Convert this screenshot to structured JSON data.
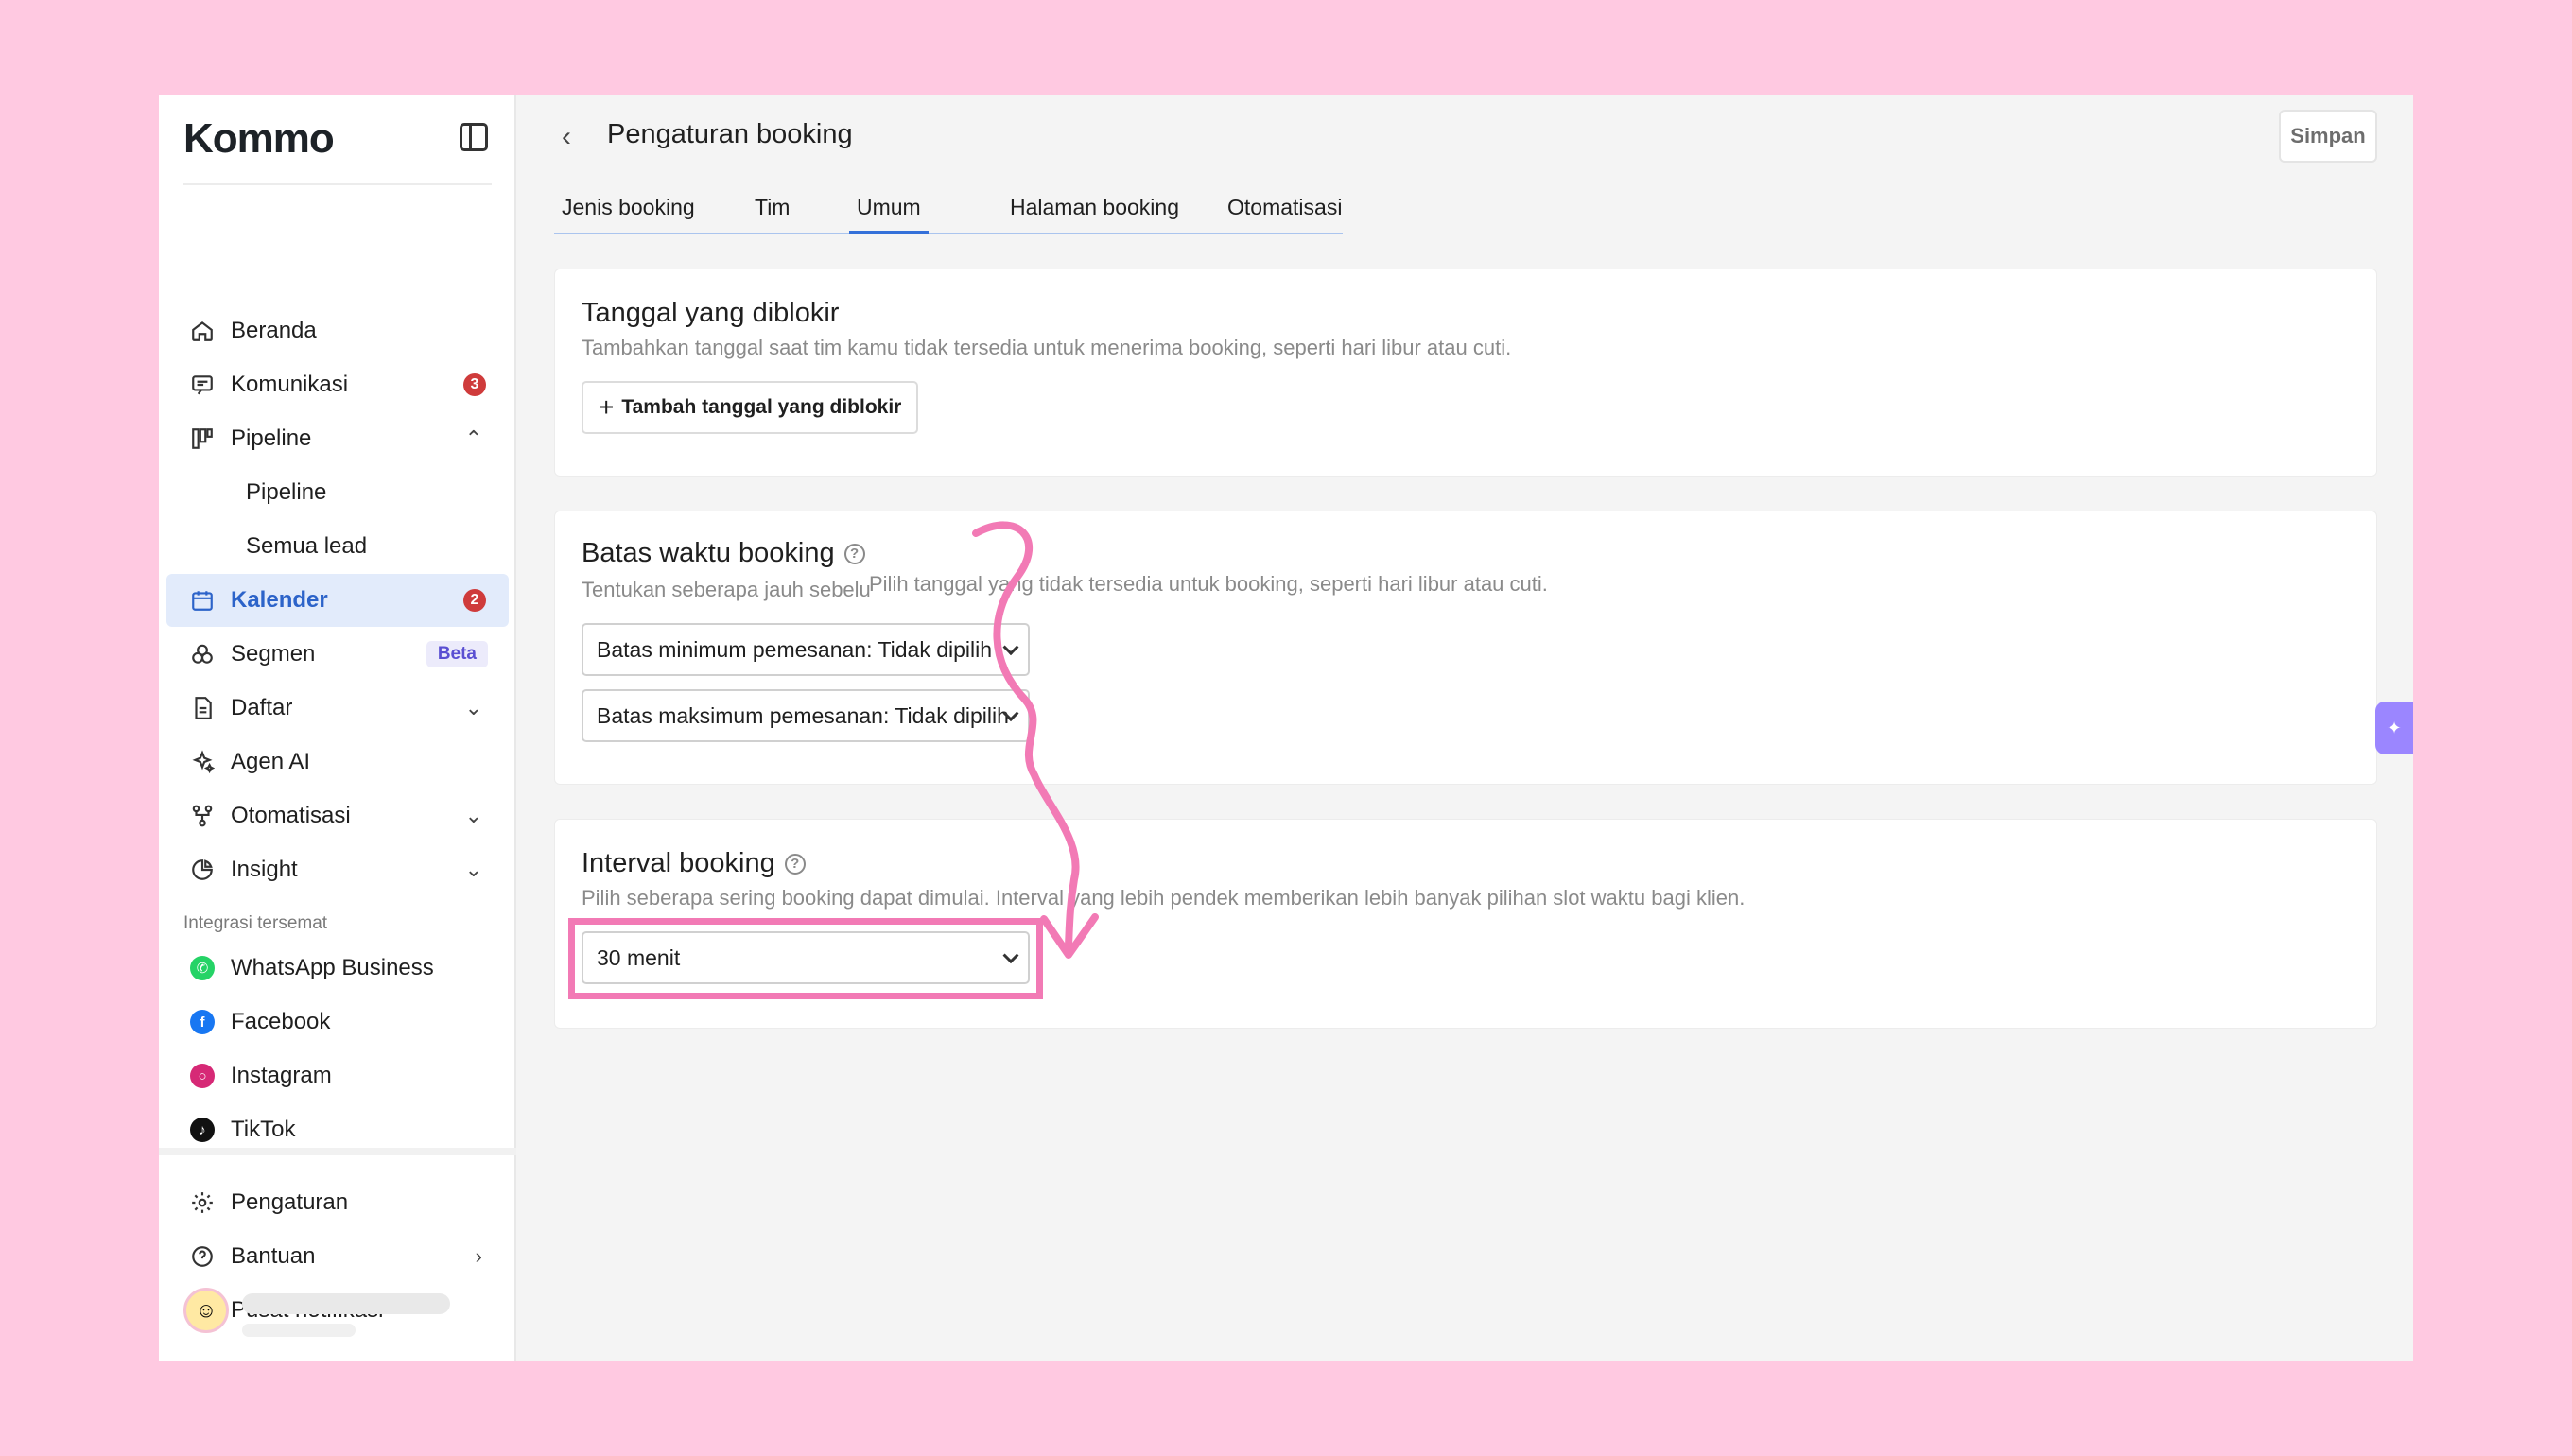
{
  "brand": {
    "name": "Kommo"
  },
  "sidebar": {
    "items": [
      {
        "label": "Beranda",
        "icon": "home-icon"
      },
      {
        "label": "Komunikasi",
        "icon": "chat-icon",
        "badge": "3"
      },
      {
        "label": "Pipeline",
        "icon": "pipeline-icon",
        "chevron": "up"
      },
      {
        "label": "Pipeline",
        "sub": true
      },
      {
        "label": "Semua lead",
        "sub": true
      },
      {
        "label": "Kalender",
        "icon": "calendar-icon",
        "badge": "2",
        "active": true
      },
      {
        "label": "Segmen",
        "icon": "segment-icon",
        "tag": "Beta"
      },
      {
        "label": "Daftar",
        "icon": "list-icon",
        "chevron": "down"
      },
      {
        "label": "Agen AI",
        "icon": "sparkle-icon"
      },
      {
        "label": "Otomatisasi",
        "icon": "automation-icon",
        "chevron": "down"
      },
      {
        "label": "Insight",
        "icon": "insight-icon",
        "chevron": "down"
      }
    ],
    "integrations_label": "Integrasi tersemat",
    "integrations": [
      {
        "label": "WhatsApp Business",
        "icon": "whatsapp-icon",
        "color": "#25d366"
      },
      {
        "label": "Facebook",
        "icon": "facebook-icon",
        "color": "#1877f2"
      },
      {
        "label": "Instagram",
        "icon": "instagram-icon",
        "color": "#d62976"
      },
      {
        "label": "TikTok",
        "icon": "tiktok-icon",
        "color": "#111111"
      }
    ],
    "bottom": [
      {
        "label": "Pengaturan",
        "icon": "gear-icon"
      },
      {
        "label": "Bantuan",
        "icon": "help-icon",
        "chevron": "right"
      },
      {
        "label": "Pusat notifikasi",
        "icon": "bell-icon"
      }
    ]
  },
  "header": {
    "title": "Pengaturan booking",
    "save_label": "Simpan"
  },
  "tabs": [
    {
      "label": "Jenis booking"
    },
    {
      "label": "Tim"
    },
    {
      "label": "Umum",
      "active": true
    },
    {
      "label": "Halaman booking"
    },
    {
      "label": "Otomatisasi"
    }
  ],
  "blocked_dates": {
    "title": "Tanggal yang diblokir",
    "description": "Tambahkan tanggal saat tim kamu tidak tersedia untuk menerima booking, seperti hari libur atau cuti.",
    "add_button": "Tambah tanggal yang diblokir"
  },
  "time_limit": {
    "title": "Batas waktu booking",
    "description": "Tentukan seberapa jauh sebelu",
    "tooltip": "Pilih tanggal yang tidak tersedia untuk booking, seperti hari libur atau cuti.",
    "min_select": "Batas minimum pemesanan: Tidak dipilih",
    "max_select": "Batas maksimum pemesanan: Tidak dipilih"
  },
  "interval": {
    "title": "Interval booking",
    "description": "Pilih seberapa sering booking dapat dimulai. Interval yang lebih pendek memberikan lebih banyak pilihan slot waktu bagi klien.",
    "value": "30 menit"
  },
  "colors": {
    "background": "#ffc9e1",
    "accent": "#3470d9",
    "highlight": "#f27ab5",
    "badge": "#cf3b3b"
  }
}
